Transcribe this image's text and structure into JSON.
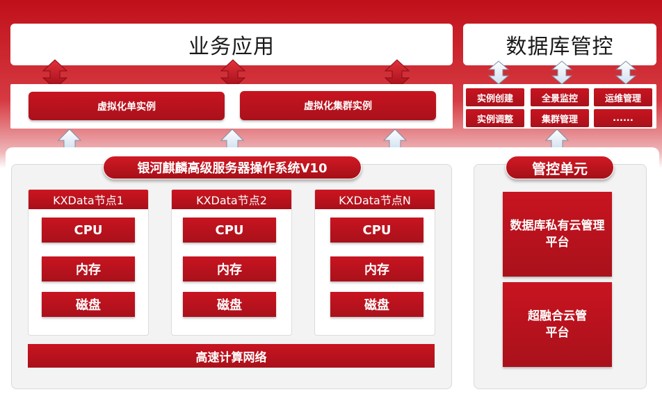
{
  "top": {
    "business_app": "业务应用",
    "db_control": "数据库管控"
  },
  "virtual": {
    "single": "虚拟化单实例",
    "cluster": "虚拟化集群实例"
  },
  "ops": [
    "实例创建",
    "全景监控",
    "运维管理",
    "实例调整",
    "集群管理",
    "......"
  ],
  "os_title": "银河麒麟高级服务器操作系统V10",
  "nodes": [
    {
      "title": "KXData节点1",
      "cpu": "CPU",
      "mem": "内存",
      "disk": "磁盘"
    },
    {
      "title": "KXData节点2",
      "cpu": "CPU",
      "mem": "内存",
      "disk": "磁盘"
    },
    {
      "title": "KXData节点N",
      "cpu": "CPU",
      "mem": "内存",
      "disk": "磁盘"
    }
  ],
  "network": "高速计算网络",
  "mgmt": {
    "title": "管控单元",
    "private_cloud": "数据库私有云管理平台",
    "hci": "超融合云管平台"
  }
}
